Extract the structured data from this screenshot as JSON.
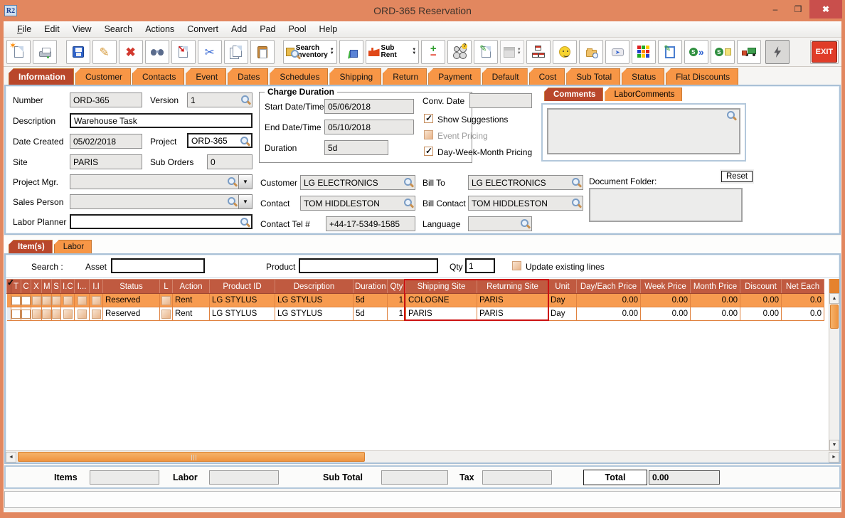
{
  "window": {
    "title": "ORD-365 Reservation",
    "app_badge": "R2"
  },
  "icons": {
    "minimize": "–",
    "maximize": "❒",
    "close": "✖",
    "pencil": "✎",
    "delete": "✖",
    "cut": "✂",
    "arrow_se": "➘",
    "star": "✶",
    "dropdown": "▼",
    "up": "▲",
    "down": "▼",
    "left": "◄",
    "right": "►",
    "send": "➤",
    "chevrons": "»",
    "s_badge": "S",
    "search_hint": "magnifier"
  },
  "menu": {
    "file_accel": "F",
    "file_rest": "ile",
    "items": [
      "Edit",
      "View",
      "Search",
      "Actions",
      "Convert",
      "Add",
      "Pad",
      "Pool",
      "Help"
    ]
  },
  "toolbar": {
    "search_inventory_line1": "Search",
    "search_inventory_line2": "Inventory",
    "sub_rent": "Sub Rent",
    "plus": "+",
    "minus": "−",
    "exit": "EXIT"
  },
  "tabs": {
    "active": "Information",
    "items": [
      "Information",
      "Customer",
      "Contacts",
      "Event",
      "Dates",
      "Schedules",
      "Shipping",
      "Return",
      "Payment",
      "Default",
      "Cost",
      "Sub Total",
      "Status",
      "Flat Discounts"
    ]
  },
  "info": {
    "number": {
      "label": "Number",
      "value": "ORD-365"
    },
    "version": {
      "label": "Version",
      "value": "1"
    },
    "description": {
      "label": "Description",
      "value": "Warehouse Task"
    },
    "date_created": {
      "label": "Date Created",
      "value": "05/02/2018"
    },
    "project": {
      "label": "Project",
      "value": "ORD-365"
    },
    "site": {
      "label": "Site",
      "value": "PARIS"
    },
    "sub_orders": {
      "label": "Sub Orders",
      "value": "0"
    },
    "project_mgr": {
      "label": "Project Mgr.",
      "value": ""
    },
    "sales_person": {
      "label": "Sales Person",
      "value": ""
    },
    "labor_planner": {
      "label": "Labor Planner",
      "value": ""
    },
    "charge_duration": {
      "title": "Charge Duration",
      "start": {
        "label": "Start Date/Time",
        "value": "05/06/2018"
      },
      "end": {
        "label": "End Date/Time",
        "value": "05/10/2018"
      },
      "duration": {
        "label": "Duration",
        "value": "5d"
      }
    },
    "conv_date": {
      "label": "Conv. Date",
      "value": ""
    },
    "show_suggestions": {
      "label": "Show Suggestions",
      "checked": true
    },
    "event_pricing": {
      "label": "Event Pricing",
      "checked": false
    },
    "day_week_month": {
      "label": "Day-Week-Month Pricing",
      "checked": true
    },
    "comments_tabs": {
      "active": "Comments",
      "items": [
        "Comments",
        "LaborComments"
      ]
    },
    "comments_value": "",
    "customer": {
      "label": "Customer",
      "value": "LG ELECTRONICS"
    },
    "bill_to": {
      "label": "Bill To",
      "value": "LG ELECTRONICS"
    },
    "contact": {
      "label": "Contact",
      "value": "TOM HIDDLESTON"
    },
    "bill_contact": {
      "label": "Bill Contact",
      "value": "TOM HIDDLESTON"
    },
    "contact_tel": {
      "label": "Contact Tel #",
      "value": "+44-17-5349-1585"
    },
    "language": {
      "label": "Language",
      "value": ""
    },
    "document_folder": {
      "label": "Document Folder:",
      "reset": "Reset",
      "value": ""
    }
  },
  "items_section": {
    "tabs": {
      "active": "Item(s)",
      "items": [
        "Item(s)",
        "Labor"
      ]
    },
    "search": {
      "label": "Search :",
      "asset_label": "Asset",
      "asset_value": "",
      "product_label": "Product",
      "product_value": "",
      "qty_label": "Qty",
      "qty_value": "1",
      "update_label": "Update existing lines",
      "update_checked": false
    },
    "table": {
      "columns": [
        "T",
        "C",
        "X",
        "M",
        "S",
        "I.C",
        "I...",
        "I.I",
        "Status",
        "L",
        "Action",
        "Product ID",
        "Description",
        "Duration",
        "Qty",
        "Shipping Site",
        "Returning Site",
        "Unit",
        "Day/Each Price",
        "Week Price",
        "Month Price",
        "Discount",
        "Net Each"
      ],
      "rows": [
        {
          "t": true,
          "c": true,
          "x": false,
          "m": false,
          "s": false,
          "ic": false,
          "idots": false,
          "ii": false,
          "status": "Reserved",
          "l": false,
          "action": "Rent",
          "product_id": "LG STYLUS",
          "description": "LG STYLUS",
          "duration": "5d",
          "qty": "1",
          "shipping_site": "COLOGNE",
          "returning_site": "PARIS",
          "unit": "Day",
          "day_each_price": "0.00",
          "week_price": "0.00",
          "month_price": "0.00",
          "discount": "0.00",
          "net_each": "0.0"
        },
        {
          "t": true,
          "c": true,
          "x": false,
          "m": false,
          "s": false,
          "ic": false,
          "idots": false,
          "ii": false,
          "status": "Reserved",
          "l": false,
          "action": "Rent",
          "product_id": "LG STYLUS",
          "description": "LG STYLUS",
          "duration": "5d",
          "qty": "1",
          "shipping_site": "PARIS",
          "returning_site": "PARIS",
          "unit": "Day",
          "day_each_price": "0.00",
          "week_price": "0.00",
          "month_price": "0.00",
          "discount": "0.00",
          "net_each": "0.0"
        }
      ]
    }
  },
  "totals": {
    "items_label": "Items",
    "items_value": "",
    "labor_label": "Labor",
    "labor_value": "",
    "sub_total_label": "Sub Total",
    "sub_total_value": "",
    "tax_label": "Tax",
    "tax_value": "",
    "total_label": "Total",
    "total_value": "0.00"
  },
  "colors": {
    "frame": "#e2875f",
    "tab_orange": "#f79646",
    "tab_active": "#b9472b",
    "grid_header": "#c05a40",
    "row_selected": "#f79b50",
    "highlight_red": "#cc1111",
    "close_red": "#c94f4c"
  }
}
